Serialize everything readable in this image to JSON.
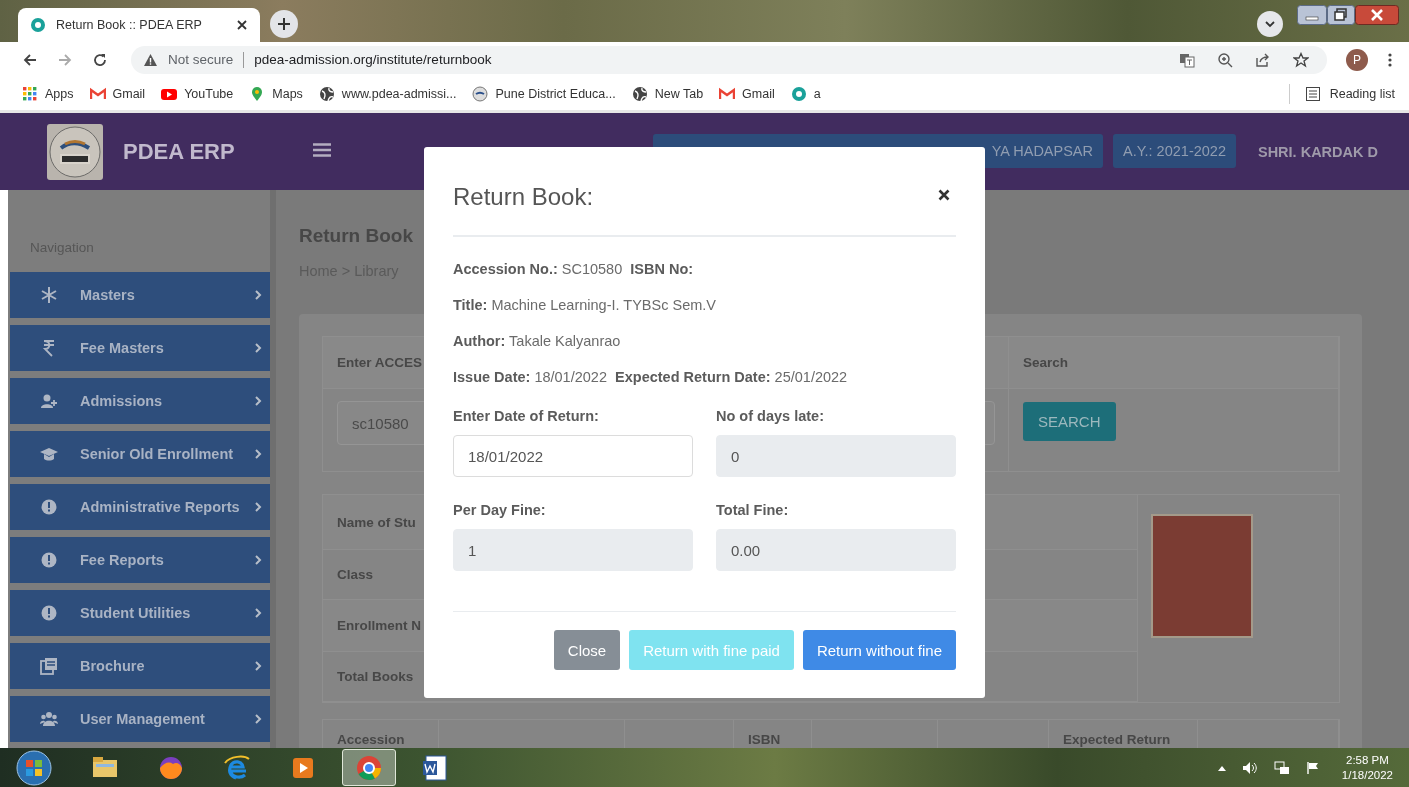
{
  "browser": {
    "tab": {
      "title": "Return Book :: PDEA ERP"
    },
    "address": {
      "security": "Not secure",
      "url": "pdea-admission.org/institute/returnbook"
    },
    "profile": "P",
    "bookmarks": [
      {
        "label": "Apps"
      },
      {
        "label": "Gmail"
      },
      {
        "label": "YouTube"
      },
      {
        "label": "Maps"
      },
      {
        "label": "www.pdea-admissi..."
      },
      {
        "label": "Pune District Educa..."
      },
      {
        "label": "New Tab"
      },
      {
        "label": "Gmail"
      },
      {
        "label": "a"
      }
    ],
    "reading_list": "Reading list"
  },
  "header": {
    "brand": "PDEA ERP",
    "badges": [
      "YA HADAPSAR",
      "A.Y.: 2021-2022"
    ],
    "user": "SHRI. KARDAK D"
  },
  "sidebar": {
    "heading": "Navigation",
    "items": [
      {
        "label": "Masters"
      },
      {
        "label": "Fee Masters"
      },
      {
        "label": "Admissions"
      },
      {
        "label": "Senior Old Enrollment"
      },
      {
        "label": "Administrative Reports"
      },
      {
        "label": "Fee Reports"
      },
      {
        "label": "Student Utilities"
      },
      {
        "label": "Brochure"
      },
      {
        "label": "User Management"
      }
    ]
  },
  "page": {
    "title": "Return Book",
    "breadcrumb": "Home > Library",
    "search_table": {
      "columns": [
        "Enter ACCES",
        "Search"
      ],
      "accession_value": "sc10580",
      "button": "SEARCH"
    },
    "student_table": {
      "rows": [
        "Name of Stu",
        "Class",
        "Enrollment N",
        "Total Books"
      ]
    },
    "books_table": {
      "columns": [
        {
          "label": "Accession"
        },
        {},
        {},
        {
          "label": "ISBN"
        },
        {},
        {},
        {
          "label": "Expected Return"
        },
        {}
      ]
    }
  },
  "modal": {
    "title": "Return Book:",
    "info": [
      "**Accession No.:** SC10580  **ISBN No:**",
      "**Title:** Machine Learning-I. TYBSc Sem.V",
      "**Author:** Takale Kalyanrao",
      "**Issue Date:** 18/01/2022  **Expected Return Date:** 25/01/2022"
    ],
    "fields": [
      {
        "label": "Enter Date of Return:",
        "value": "18/01/2022",
        "disabled": false
      },
      {
        "label": "No of days late:",
        "value": "0",
        "disabled": true
      },
      {
        "label": "Per Day Fine:",
        "value": "1",
        "disabled": true
      },
      {
        "label": "Total Fine:",
        "value": "0.00",
        "disabled": true
      }
    ],
    "buttons": [
      {
        "label": "Close",
        "kind": "secondary",
        "disabled": false
      },
      {
        "label": "Return with fine paid",
        "kind": "info",
        "disabled": true
      },
      {
        "label": "Return without fine",
        "kind": "primary",
        "disabled": false
      }
    ]
  },
  "taskbar": {
    "apps": [
      {
        "active": false
      },
      {
        "active": false
      },
      {
        "active": false
      },
      {
        "active": false
      },
      {
        "active": true
      },
      {
        "active": false
      }
    ],
    "clock": {
      "time": "2:58 PM",
      "date": "1/18/2022"
    }
  }
}
